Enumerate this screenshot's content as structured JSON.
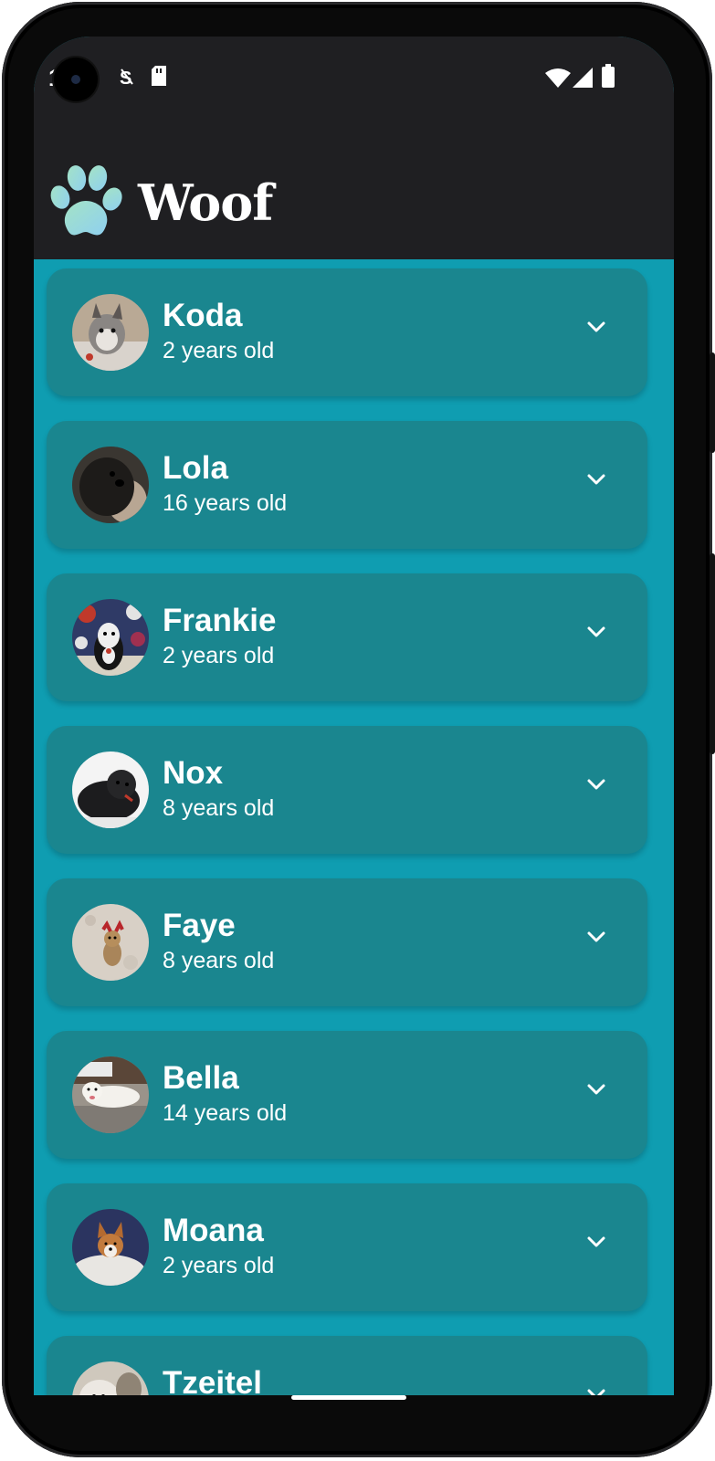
{
  "status_bar": {
    "time": "1:55",
    "icons": [
      "sd-card-icon",
      "wifi-icon",
      "cell-signal-icon",
      "battery-icon"
    ]
  },
  "app_bar": {
    "title": "Woof",
    "logo": "paw-logo"
  },
  "colors": {
    "background": "#0f9db1",
    "card": "#1a868f",
    "bar": "#1f1f22",
    "text": "#ffffff"
  },
  "dogs": [
    {
      "name": "Koda",
      "age": "2 years old",
      "photo": "gray husky"
    },
    {
      "name": "Lola",
      "age": "16 years old",
      "photo": "black curly dog"
    },
    {
      "name": "Frankie",
      "age": "2 years old",
      "photo": "black and white dog"
    },
    {
      "name": "Nox",
      "age": "8 years old",
      "photo": "black dog"
    },
    {
      "name": "Faye",
      "age": "8 years old",
      "photo": "small tan dog"
    },
    {
      "name": "Bella",
      "age": "14 years old",
      "photo": "white dog on gravel"
    },
    {
      "name": "Moana",
      "age": "2 years old",
      "photo": "corgi"
    },
    {
      "name": "Tzeitel",
      "age": "",
      "photo": "white fluffy dog"
    }
  ]
}
